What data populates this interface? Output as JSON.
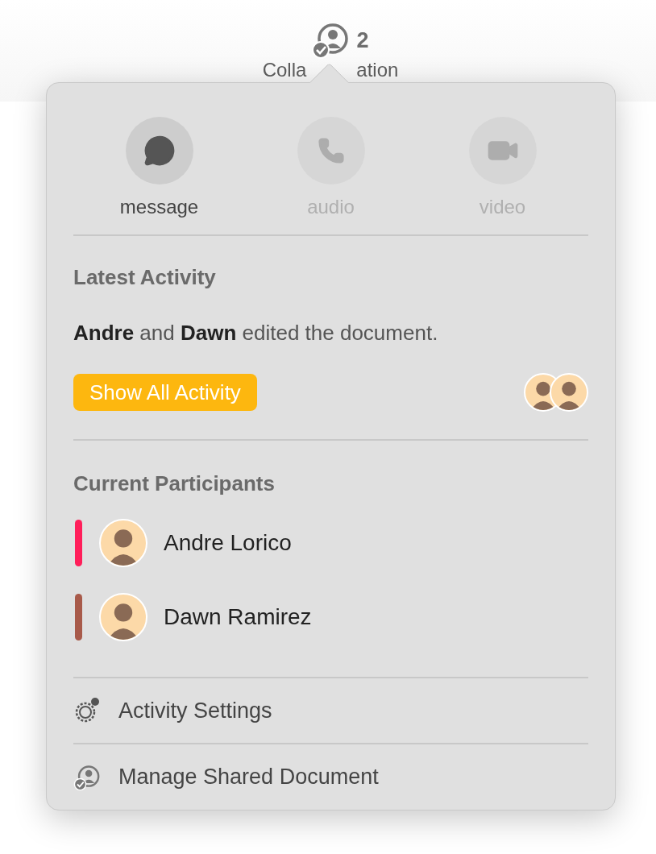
{
  "toolbar": {
    "count": "2",
    "label_parts": [
      "Colla",
      "ation"
    ]
  },
  "popover": {
    "actions": [
      {
        "kind": "message",
        "label": "message",
        "disabled": false
      },
      {
        "kind": "audio",
        "label": "audio",
        "disabled": true
      },
      {
        "kind": "video",
        "label": "video",
        "disabled": true
      }
    ],
    "latest_activity": {
      "heading": "Latest Activity",
      "summary": "**Andre** and **Dawn** edited the document.",
      "button": "Show All Activity"
    },
    "participants": {
      "heading": "Current Participants",
      "people": [
        {
          "name": "Andre Lorico",
          "color": "#ff1f5a"
        },
        {
          "name": "Dawn Ramirez",
          "color": "#a85a4a"
        }
      ]
    },
    "menu": [
      {
        "kind": "settings",
        "label": "Activity Settings"
      },
      {
        "kind": "manage",
        "label": "Manage Shared Document"
      }
    ]
  }
}
